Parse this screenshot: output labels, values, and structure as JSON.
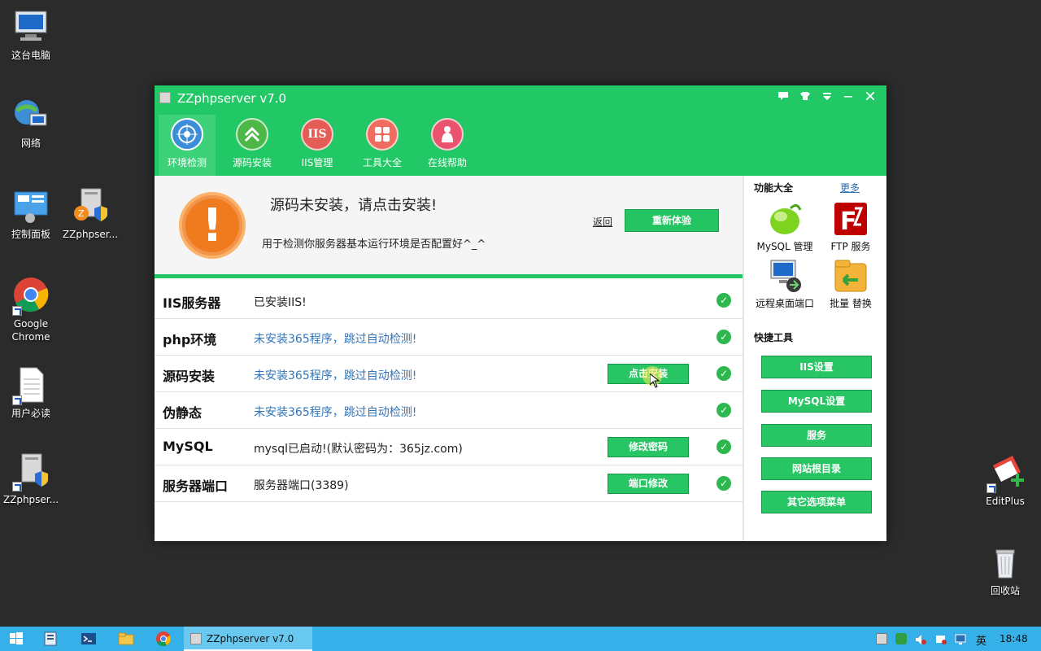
{
  "desktop": {
    "icons": [
      {
        "label": "这台电脑",
        "icon": "computer-icon"
      },
      {
        "label": "网络",
        "icon": "network-icon"
      },
      {
        "label": "控制面板",
        "icon": "control-panel-icon"
      },
      {
        "label": "ZZphpser...",
        "icon": "zzphpserver-icon"
      },
      {
        "label": "Google\nChrome",
        "icon": "chrome-icon"
      },
      {
        "label": "用户必读",
        "icon": "document-icon"
      },
      {
        "label": "ZZphpser...",
        "icon": "zzphpserver-icon"
      },
      {
        "label": "EditPlus",
        "icon": "editplus-icon"
      },
      {
        "label": "回收站",
        "icon": "recycle-bin-icon"
      }
    ]
  },
  "window": {
    "title": "ZZphpserver v7.0",
    "tabs": [
      {
        "label": "环境检测",
        "glyph": "◈"
      },
      {
        "label": "源码安装",
        "glyph": "⌃"
      },
      {
        "label": "IIS管理",
        "glyph": "IIS"
      },
      {
        "label": "工具大全",
        "glyph": "▦"
      },
      {
        "label": "在线帮助",
        "glyph": "⚇"
      }
    ],
    "colors": {
      "primary": "#22c865",
      "link": "#3075b8",
      "warning": "#f07a1e"
    }
  },
  "notice": {
    "title": "源码未安装，请点击安装!",
    "subtitle": "用于检测你服务器基本运行环境是否配置好^_^",
    "back_link": "返回",
    "retry_button": "重新体验"
  },
  "checks": [
    {
      "name": "IIS服务器",
      "value": "已安装IIS!",
      "button": ""
    },
    {
      "name": "php环境",
      "value": "未安装365程序，跳过自动检测!",
      "button": ""
    },
    {
      "name": "源码安装",
      "value": "未安装365程序，跳过自动检测!",
      "button": "点击安装"
    },
    {
      "name": "伪静态",
      "value": "未安装365程序，跳过自动检测!",
      "button": ""
    },
    {
      "name": "MySQL",
      "value": "mysql已启动!(默认密码为：365jz.com)",
      "button": "修改密码"
    },
    {
      "name": "服务器端口",
      "value": "服务器端口(3389)",
      "button": "端口修改"
    }
  ],
  "right_panel": {
    "functions_title": "功能大全",
    "more_link": "更多",
    "tools": [
      {
        "label": "MySQL 管理",
        "icon": "mysql-icon"
      },
      {
        "label": "FTP 服务",
        "icon": "filezilla-icon"
      },
      {
        "label": "远程桌面端口",
        "icon": "remote-desktop-icon"
      },
      {
        "label": "批量 替换",
        "icon": "batch-replace-icon"
      }
    ],
    "quick_title": "快捷工具",
    "quick_buttons": [
      "IIS设置",
      "MySQL设置",
      "服务",
      "网站根目录",
      "其它选项菜单"
    ]
  },
  "taskbar": {
    "task_label": "ZZphpserver v7.0",
    "ime": "英",
    "time": "18:48"
  }
}
